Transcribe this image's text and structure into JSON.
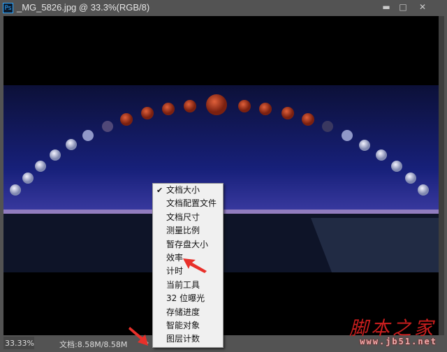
{
  "window": {
    "app_icon": "Ps",
    "title": "_MG_5826.jpg @ 33.3%(RGB/8)",
    "minimize": "▬",
    "maximize": "□",
    "close": "✕"
  },
  "status": {
    "zoom": "33.33%",
    "doc_info": "文档:8.58M/8.58M",
    "menu_arrow": "›"
  },
  "menu": {
    "checked_index": 0,
    "items": [
      "文档大小",
      "文档配置文件",
      "文档尺寸",
      "测量比例",
      "暂存盘大小",
      "效率",
      "计时",
      "当前工具",
      "32 位曝光",
      "存储进度",
      "智能对象",
      "图层计数"
    ]
  },
  "watermark": {
    "name": "脚本之家",
    "url": "www.jb51.net"
  },
  "colors": {
    "annotation_arrow": "#e8302a",
    "ps_blue": "#31a8ff"
  }
}
